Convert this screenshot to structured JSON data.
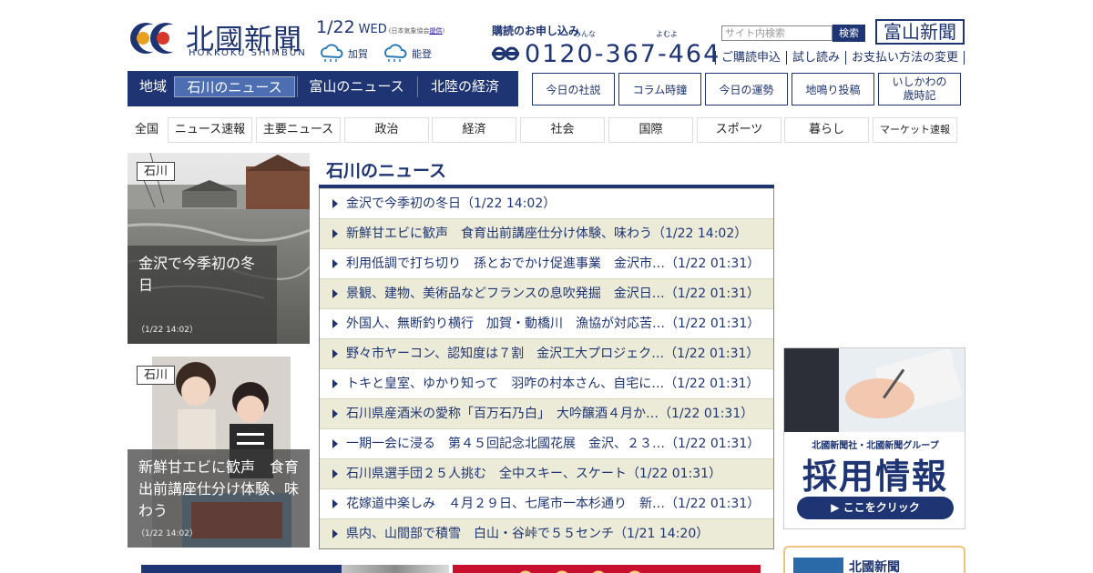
{
  "header": {
    "logo_text": "北國新聞",
    "logo_roman": "HOKKOKU SHIMBUN",
    "date": "1/22",
    "weekday": "WED",
    "weather_source_prefix": "(日本気象協会",
    "weather_source_link": "提供",
    "weather_source_suffix": ")",
    "weather": [
      {
        "area": "加賀",
        "icon": "cloudy-icon"
      },
      {
        "area": "能登",
        "icon": "cloudy-icon"
      }
    ],
    "subscribe_title": "購読のお申し込み",
    "furigana_1": "みんな",
    "furigana_2": "よむよ",
    "phone": "0120-367-464",
    "search_placeholder": "サイト内検索",
    "search_button": "検索",
    "toyama_button": "富山新聞",
    "util_links": [
      "ご購読申込",
      "試し読み",
      "お支払い方法の変更"
    ]
  },
  "region_nav": {
    "label": "地域",
    "items": [
      "石川のニュース",
      "富山のニュース",
      "北陸の経済"
    ],
    "active_index": 0
  },
  "feature_buttons": [
    "今日の社説",
    "コラム時鐘",
    "今日の運勢",
    "地鳴り投稿",
    "いしかわの\n歳時記"
  ],
  "category_nav": {
    "label": "全国",
    "items": [
      "ニュース速報",
      "主要ニュース",
      "政治",
      "経済",
      "社会",
      "国際",
      "スポーツ",
      "暮らし",
      "マーケット速報"
    ]
  },
  "photos": [
    {
      "tag": "石川",
      "title": "金沢で今季初の冬日",
      "time": "（1/22 14:02）"
    },
    {
      "tag": "石川",
      "title": "新鮮甘エビに歓声　食育出前講座仕分け体験、味わう",
      "time": "（1/22 14:02）"
    }
  ],
  "news": {
    "heading": "石川のニュース",
    "items": [
      "金沢で今季初の冬日（1/22 14:02）",
      "新鮮甘エビに歓声　食育出前講座仕分け体験、味わう（1/22 14:02）",
      "利用低調で打ち切り　孫とおでかけ促進事業　金沢市…（1/22 01:31）",
      "景観、建物、美術品などフランスの息吹発掘　金沢日…（1/22 01:31）",
      "外国人、無断釣り横行　加賀・動橋川　漁協が対応苦…（1/22 01:31）",
      "野々市ヤーコン、認知度は７割　金沢工大プロジェク…（1/22 01:31）",
      "トキと皇室、ゆかり知って　羽咋の村本さん、自宅に…（1/22 01:31）",
      "石川県産酒米の愛称「百万石乃白」　大吟醸酒４月か…（1/22 01:31）",
      "一期一会に浸る　第４５回記念北國花展　金沢、２３…（1/22 01:31）",
      "石川県選手団２５人挑む　全中スキー、スケート（1/22 01:31）",
      "花嫁道中楽しみ　４月２９日、七尾市一本杉通り　新…（1/22 01:31）",
      "県内、山間部で積雪　白山・谷峠で５５センチ（1/21 14:20）"
    ]
  },
  "recruit_banner": {
    "company": "北國新聞社・北國新聞グループ",
    "title": "採用情報",
    "button": "▶ ここをクリック"
  },
  "promo_box": {
    "name": "北國新聞"
  },
  "colors": {
    "brand": "#1e3473",
    "row_alt": "#ecebd8",
    "active_tab": "#4d6fb2"
  }
}
